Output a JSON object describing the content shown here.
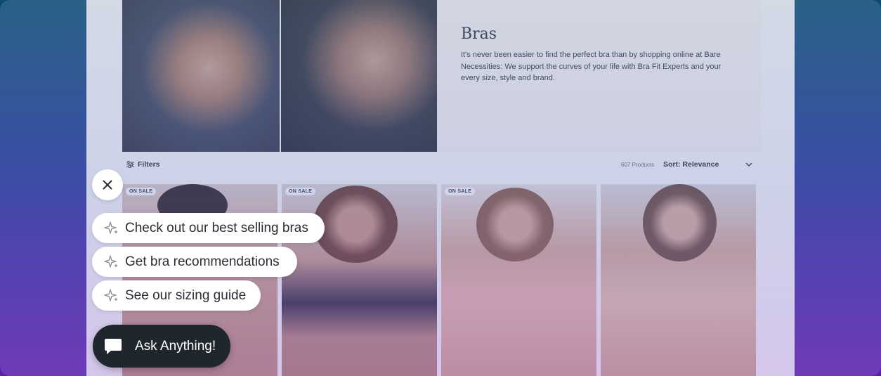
{
  "category": {
    "title": "Bras",
    "description": "It's never been easier to find the perfect bra than by shopping online at Bare Necessities: We support the curves of your life with Bra Fit Experts and your every size, style and brand."
  },
  "toolbar": {
    "filters_label": "Filters",
    "filters_icon": "sliders-icon",
    "product_count": "607 Products",
    "sort_label": "Sort: Relevance",
    "sort_icon": "chevron-down-icon"
  },
  "products": [
    {
      "badge": "ON SALE"
    },
    {
      "badge": "ON SALE"
    },
    {
      "badge": "ON SALE"
    },
    {
      "badge": ""
    }
  ],
  "assistant": {
    "close_icon": "close-icon",
    "suggestions": [
      {
        "label": "Check out our best selling bras",
        "icon": "sparkle-icon"
      },
      {
        "label": "Get bra recommendations",
        "icon": "sparkle-icon"
      },
      {
        "label": "See our sizing guide",
        "icon": "sparkle-icon"
      }
    ],
    "ask_label": "Ask Anything!",
    "ask_icon": "chat-bubble-icon"
  },
  "colors": {
    "ask_button_bg": "#1f262d",
    "chip_bg": "#ffffff",
    "backdrop_top": "#0b4b6c",
    "backdrop_bottom": "#5a1fa6"
  }
}
